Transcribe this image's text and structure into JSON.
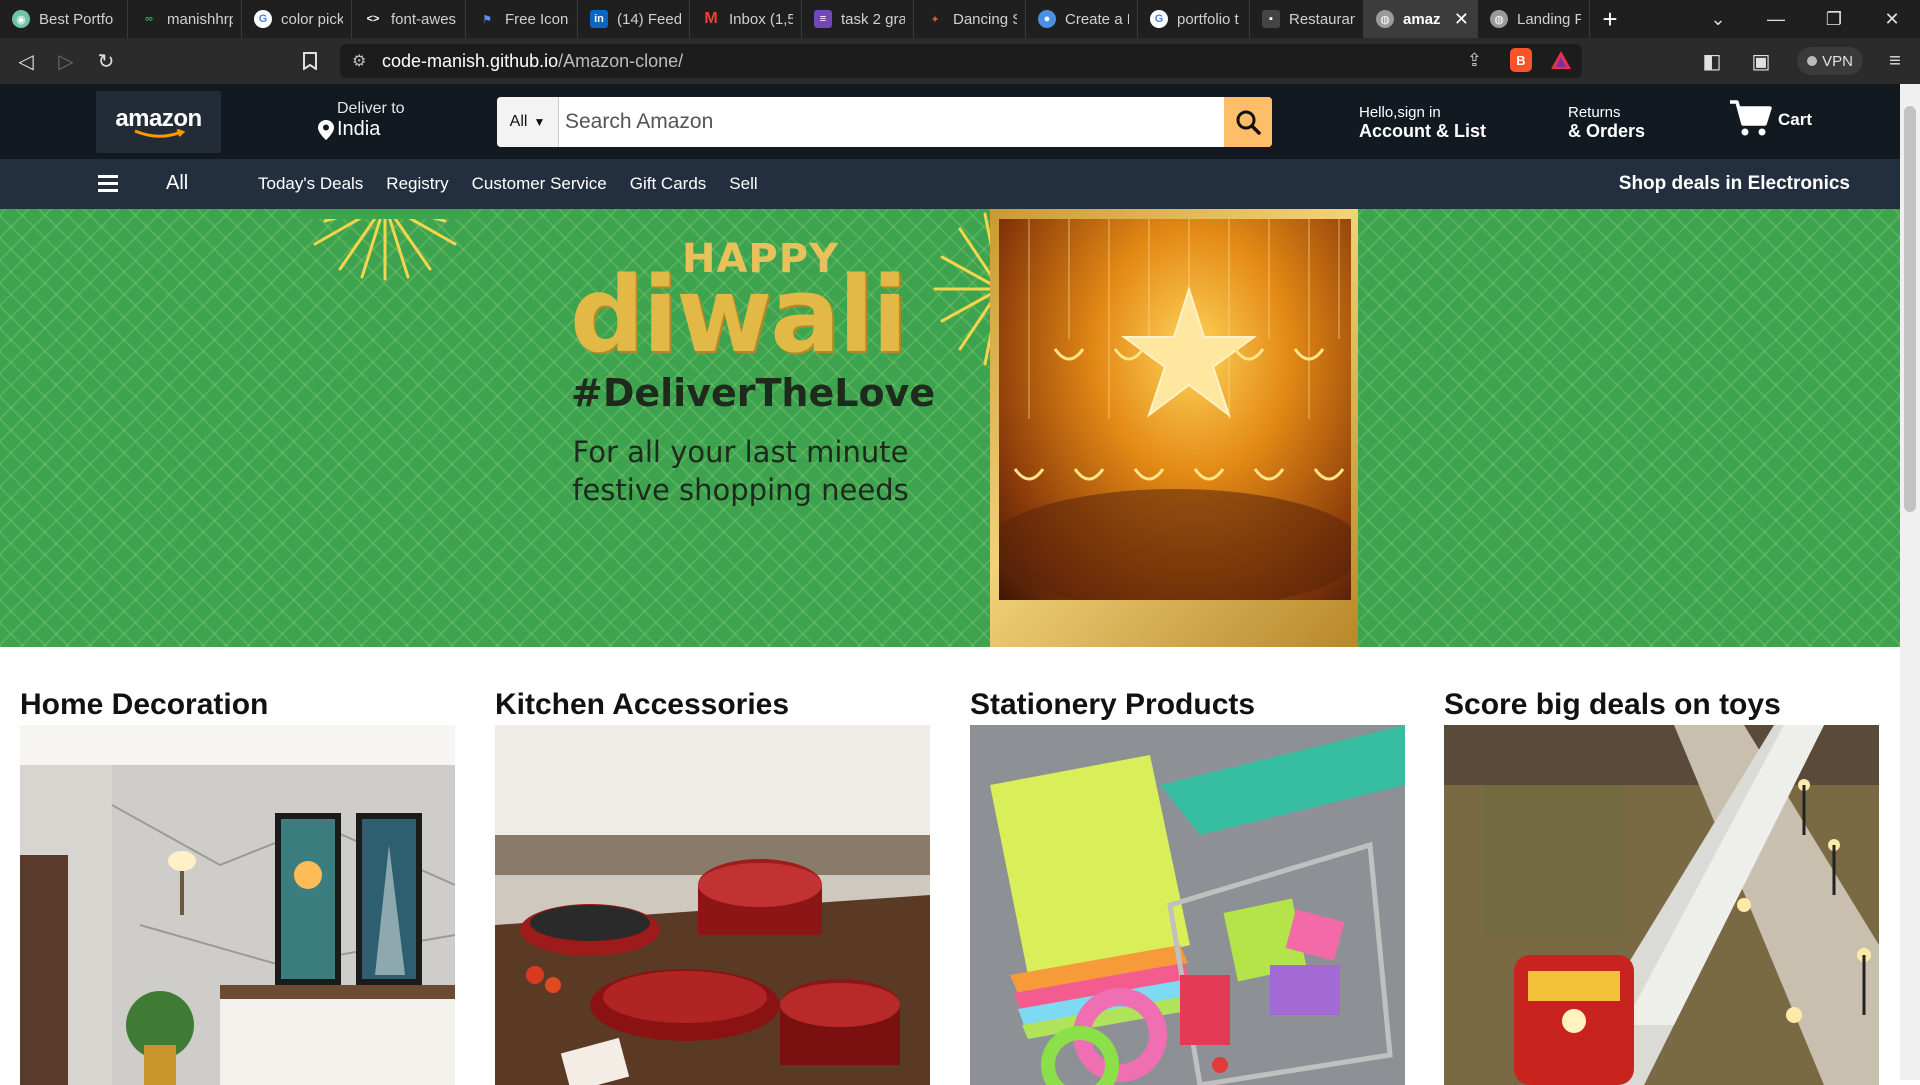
{
  "browser": {
    "tabs": [
      {
        "title": "Best Portfo",
        "icon": "sphere-icon",
        "color": "#6cc5a8"
      },
      {
        "title": "manishhrp",
        "icon": "github-icon",
        "color": "#2fa84f"
      },
      {
        "title": "color picke",
        "icon": "google-icon",
        "color": "#ffffff"
      },
      {
        "title": "font-awes",
        "icon": "code-icon",
        "color": "#ffffff"
      },
      {
        "title": "Free Icons",
        "icon": "flag-icon",
        "color": "#5a8ff5"
      },
      {
        "title": "(14) Feed",
        "icon": "linkedin-icon",
        "color": "#0a66c2"
      },
      {
        "title": "Inbox (1,5",
        "icon": "gmail-icon",
        "color": "#ea4335"
      },
      {
        "title": "task 2 gra",
        "icon": "form-icon",
        "color": "#7248b9"
      },
      {
        "title": "Dancing S",
        "icon": "figma-icon",
        "color": "#f24e1e"
      },
      {
        "title": "Create a F",
        "icon": "chrome-icon",
        "color": "#4a90e2"
      },
      {
        "title": "portfolio t",
        "icon": "google-icon",
        "color": "#ffffff"
      },
      {
        "title": "Restauran",
        "icon": "folder-icon",
        "color": "#444444"
      },
      {
        "title": "amaz",
        "icon": "globe-icon",
        "color": "#9a9a9a",
        "active": true
      },
      {
        "title": "Landing P",
        "icon": "globe-icon",
        "color": "#9a9a9a"
      }
    ],
    "url_host": "code-manish.github.io",
    "url_path": "/Amazon-clone/",
    "vpn_label": "VPN"
  },
  "header": {
    "logo": "amazon",
    "deliver_label": "Deliver to",
    "deliver_location": "India",
    "search_category": "All",
    "search_placeholder": "Search Amazon",
    "account_line1": "Hello,sign in",
    "account_line2": "Account & List",
    "returns_line1": "Returns",
    "returns_line2": "& Orders",
    "cart_label": "Cart"
  },
  "nav": {
    "all_label": "All",
    "links": [
      "Today's Deals",
      "Registry",
      "Customer Service",
      "Gift Cards",
      "Sell"
    ],
    "deals_link": "Shop deals in Electronics"
  },
  "hero": {
    "title_small": "HAPPY",
    "title_big": "diwali",
    "hashtag": "#DeliverTheLove",
    "subtitle": "For all your last minute festive shopping needs"
  },
  "cards": [
    {
      "title": "Home Decoration",
      "image": "home-decoration-image"
    },
    {
      "title": "Kitchen Accessories",
      "image": "kitchen-accessories-image"
    },
    {
      "title": "Stationery Products",
      "image": "stationery-products-image"
    },
    {
      "title": "Score big deals on toys",
      "image": "toys-train-image"
    }
  ],
  "colors": {
    "header_bg": "#131921",
    "nav_bg": "#232f3e",
    "search_button": "#febd69",
    "hero_green": "#3da34f",
    "hero_gold": "#e2b947"
  }
}
